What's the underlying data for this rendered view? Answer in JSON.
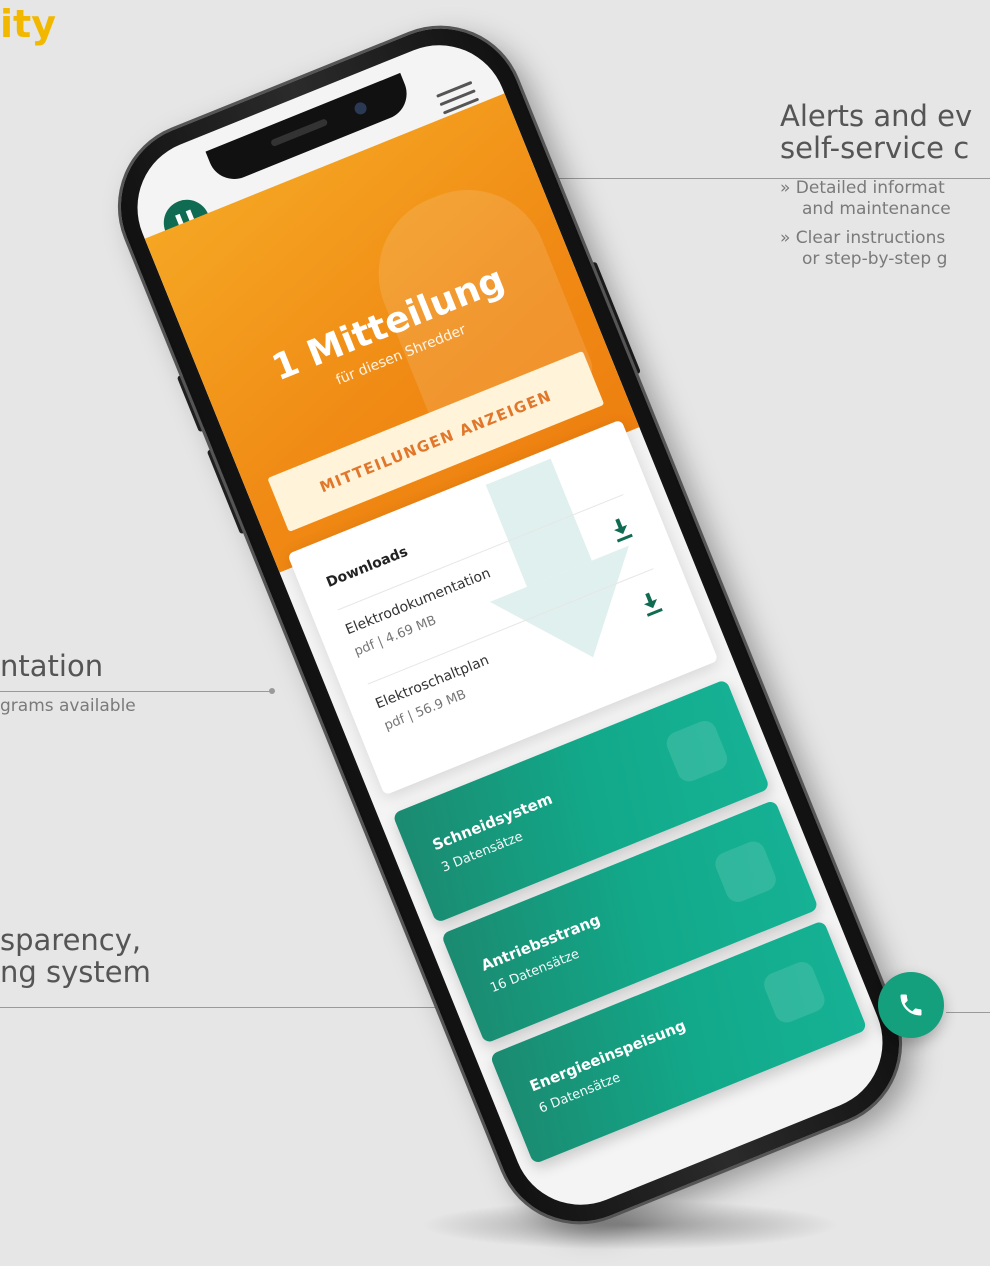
{
  "page": {
    "corner_title": "ity",
    "annotations": {
      "alerts": {
        "title_line1": "Alerts and ev",
        "title_line2": "self-service c",
        "bullet1_line1": "» Detailed informat",
        "bullet1_line2": "and maintenance",
        "bullet2_line1": "» Clear instructions",
        "bullet2_line2": "or step-by-step g"
      },
      "documentation": {
        "title": "ntation",
        "sub": "grams available"
      },
      "transparency": {
        "line1": "sparency,",
        "line2": "ng system"
      }
    }
  },
  "app": {
    "logo_letter": "U",
    "alert_card": {
      "count": "1 Mitteilung",
      "subtitle": "für diesen Shredder",
      "button": "MITTEILUNGEN ANZEIGEN"
    },
    "downloads": {
      "title": "Downloads",
      "items": [
        {
          "name": "Elektrodokumentation",
          "meta": "pdf | 4.69 MB"
        },
        {
          "name": "Elektroschaltplan",
          "meta": "pdf | 56.9 MB"
        }
      ]
    },
    "systems": [
      {
        "name": "Schneidsystem",
        "count": "3 Datensätze",
        "icon": "gear-icon"
      },
      {
        "name": "Antriebsstrang",
        "count": "16 Datensätze",
        "icon": "document-icon"
      },
      {
        "name": "Energieeinspeisung",
        "count": "6 Datensätze",
        "icon": "lightning-icon"
      }
    ],
    "colors": {
      "accent_orange": "#f08a14",
      "accent_green": "#12a98a",
      "brand_dark_green": "#0f6b52",
      "title_yellow": "#f2b800"
    }
  }
}
